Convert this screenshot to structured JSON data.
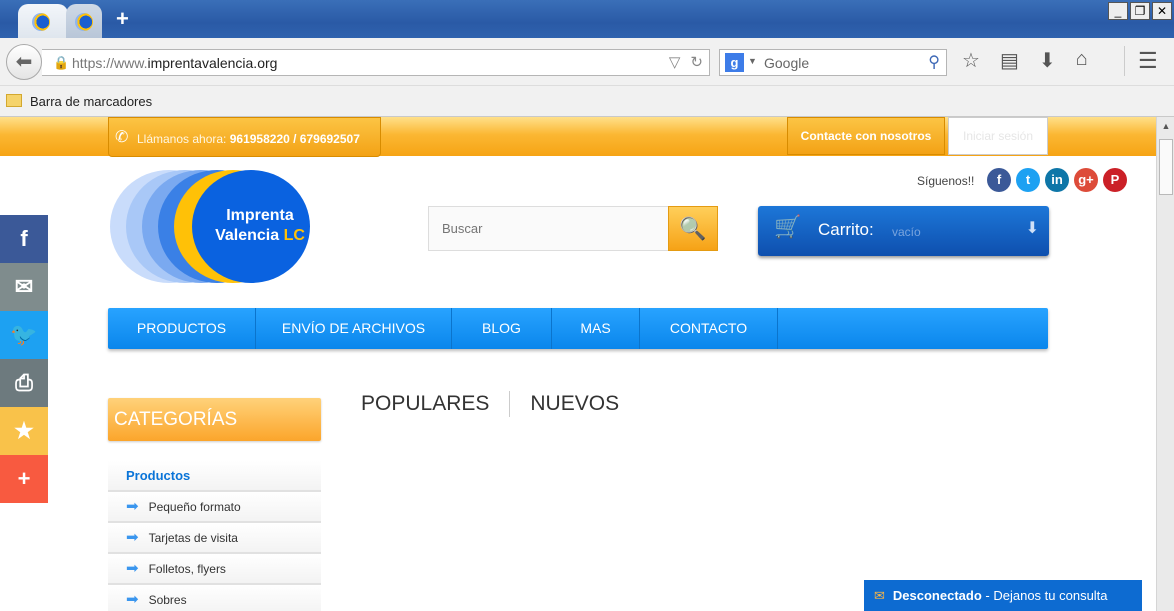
{
  "browser": {
    "url_prefix": "https://www.",
    "url_host": "imprentavalencia.org",
    "search_engine": "Google",
    "bookmarks_label": "Barra de marcadores"
  },
  "topbar": {
    "call_label": "Llámanos ahora:",
    "phones": "961958220 / 679692507",
    "contact_button": "Contacte con nosotros",
    "login_button": "Iniciar sesión"
  },
  "logo": {
    "line1": "Imprenta",
    "line2": "Valencia",
    "suffix": "LC"
  },
  "social": {
    "label": "Síguenos!!",
    "icons": [
      "facebook-icon",
      "twitter-icon",
      "linkedin-icon",
      "google-plus-icon",
      "pinterest-icon"
    ]
  },
  "search": {
    "placeholder": "Buscar"
  },
  "cart": {
    "title": "Carrito:",
    "status": "vacío"
  },
  "nav": {
    "items": [
      {
        "label": "PRODUCTOS"
      },
      {
        "label": "ENVÍO DE ARCHIVOS"
      },
      {
        "label": "BLOG"
      },
      {
        "label": "MAS"
      },
      {
        "label": "CONTACTO"
      }
    ]
  },
  "sidebar_share": {
    "icons": [
      "facebook-icon",
      "email-icon",
      "twitter-icon",
      "print-icon",
      "favorite-icon",
      "more-icon"
    ],
    "colors": [
      "#3b5998",
      "#7f8c8d",
      "#1da1f2",
      "#6d7a7e",
      "#f9c24a",
      "#f85a40"
    ]
  },
  "categories": {
    "title": "CATEGORÍAS",
    "head": "Productos",
    "items": [
      "Pequeño formato",
      "Tarjetas de visita",
      "Folletos, flyers",
      "Sobres"
    ]
  },
  "product_tabs": {
    "popular": "POPULARES",
    "new": "NUEVOS"
  },
  "chat": {
    "status": "Desconectado",
    "message": "- Dejanos tu consulta"
  },
  "colors": {
    "accent_orange": "#f6a414",
    "nav_blue": "#0a86ec",
    "cart_blue": "#0e4fae",
    "chat_blue": "#0d6bd1"
  }
}
